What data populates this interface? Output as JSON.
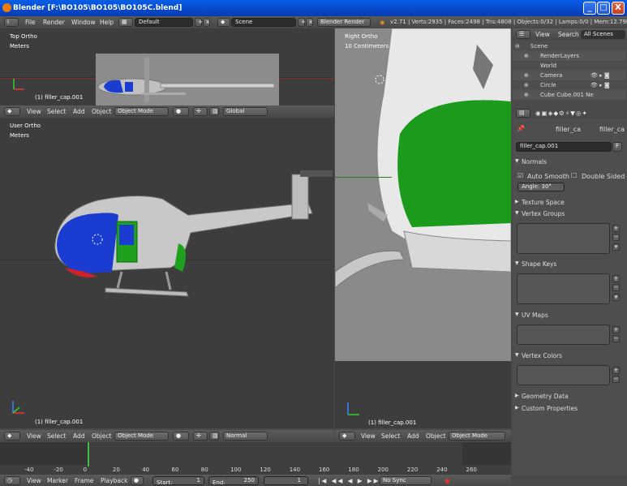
{
  "window": {
    "title": "Blender [F:\\BO105\\BO105\\BO105C.blend]",
    "min": "_",
    "max": "□",
    "close": "X"
  },
  "info_header": {
    "menus": [
      "File",
      "Render",
      "Window",
      "Help"
    ],
    "layout": "Default",
    "scene": "Scene",
    "engine": "Blender Render",
    "stats": "v2.71 | Verts:2935 | Faces:2498 | Tris:4808 | Objects:0/32 | Lamps:0/0 | Mem:12.79M (2.64M"
  },
  "top_left_view": {
    "name": "Top Ortho",
    "units": "Meters",
    "object": "(1) filler_cap.001"
  },
  "user_view": {
    "name": "User Ortho",
    "units": "Meters",
    "object": "(1) filler_cap.001"
  },
  "right_view": {
    "name": "Right Ortho",
    "units": "10 Centimeters",
    "object": "(1) filler_cap.001"
  },
  "view3d_header_top": {
    "menus": [
      "View",
      "Select",
      "Add",
      "Object"
    ],
    "mode": "Object Mode",
    "orientation": "Global"
  },
  "view3d_header_bottom": {
    "menus": [
      "View",
      "Select",
      "Add",
      "Object"
    ],
    "mode": "Object Mode",
    "orientation": "Normal"
  },
  "view3d_header_right": {
    "menus": [
      "View",
      "Select",
      "Add",
      "Object"
    ],
    "mode": "Object Mode"
  },
  "outliner": {
    "tabs": [
      "View",
      "Search",
      "All Scenes"
    ],
    "items": [
      "Scene",
      "RenderLayers",
      "World",
      "Camera",
      "Circle",
      "Cube  Cube.001  Ne"
    ]
  },
  "properties": {
    "breadcrumb": [
      "filler_ca",
      "filler_ca"
    ],
    "mesh_name": "filler_cap.001",
    "fake_user": "F",
    "normals": {
      "title": "Normals",
      "auto_smooth": "Auto Smooth",
      "double_sided": "Double Sided",
      "angle_label": "Angle:",
      "angle": "30°"
    },
    "panels": [
      "Texture Space",
      "Vertex Groups",
      "Shape Keys",
      "UV Maps",
      "Vertex Colors",
      "Geometry Data",
      "Custom Properties"
    ]
  },
  "timeline": {
    "ticks": [
      "-40",
      "-20",
      "0",
      "20",
      "40",
      "60",
      "80",
      "100",
      "120",
      "140",
      "160",
      "180",
      "200",
      "220",
      "240",
      "260"
    ],
    "current_frame_pos": 0,
    "menus": [
      "View",
      "Marker",
      "Frame",
      "Playback"
    ],
    "start_label": "Start:",
    "start": "1",
    "end_label": "End:",
    "end": "250",
    "current": "1",
    "sync": "No Sync"
  },
  "colors": {
    "header": "#474747",
    "viewport": "#3d3d3d",
    "blue_panel": "#1a3cd0",
    "green_panel": "#1fa01f"
  }
}
